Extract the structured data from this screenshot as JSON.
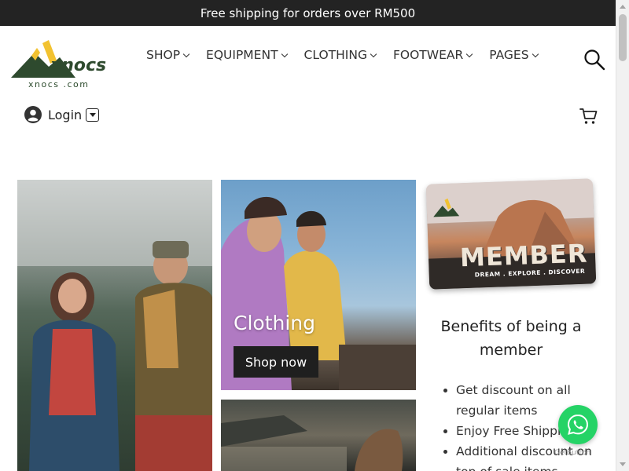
{
  "announcement": "Free shipping for orders over RM500",
  "brand": {
    "logo_word": "xnocs",
    "domain": "xnocs .com"
  },
  "nav": [
    {
      "label": "SHOP"
    },
    {
      "label": "EQUIPMENT"
    },
    {
      "label": "CLOTHING"
    },
    {
      "label": "FOOTWEAR"
    },
    {
      "label": "PAGES"
    }
  ],
  "account": {
    "login_label": "Login"
  },
  "icons": {
    "search": "search-icon",
    "cart": "cart-icon",
    "user": "user-icon",
    "whatsapp": "whatsapp-icon"
  },
  "cards": {
    "clothing": {
      "title": "Clothing",
      "button": "Shop now"
    }
  },
  "member_card": {
    "word": "MEMBER",
    "tagline": "DREAM . EXPLORE . DISCOVER"
  },
  "benefits": {
    "title": "Benefits of being a member",
    "items": [
      "Get discount on all regular items",
      "Enjoy Free Shipping",
      "Additional discount on top of sale items"
    ]
  },
  "whatsapp": {
    "caption": "GetButton"
  },
  "colors": {
    "topbar": "#232323",
    "whatsapp": "#25d366",
    "button": "#1f1f1f",
    "logo_green": "#2e4a2e",
    "logo_yellow": "#f2c230"
  }
}
